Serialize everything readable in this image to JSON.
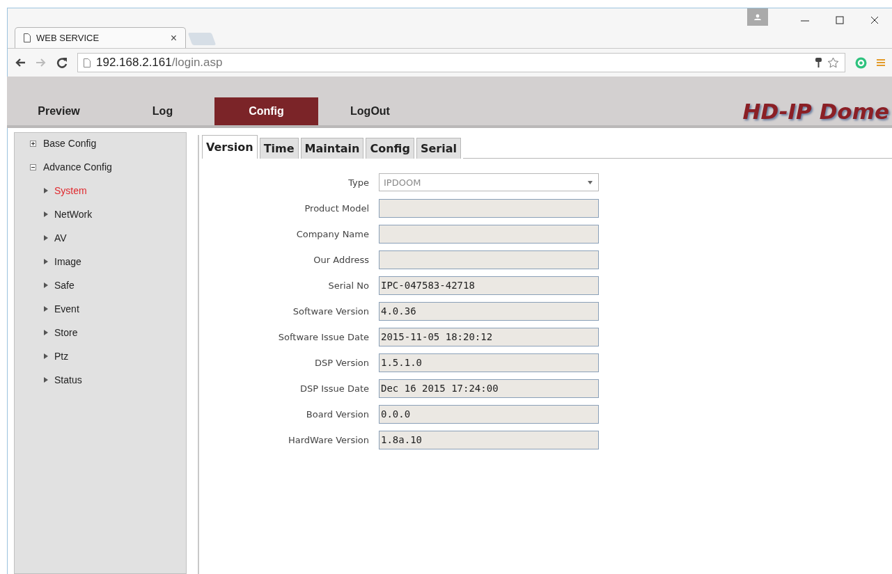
{
  "browser": {
    "tab_title": "WEB SERVICE",
    "tab_close": "×",
    "url_host": "192.168.2.161",
    "url_path": "/login.asp"
  },
  "nav": {
    "items": [
      {
        "label": "Preview",
        "selected": false
      },
      {
        "label": "Log",
        "selected": false
      },
      {
        "label": "Config",
        "selected": true
      },
      {
        "label": "LogOut",
        "selected": false
      }
    ],
    "logo": "HD-IP Dome"
  },
  "sidebar": {
    "items": [
      {
        "label": "Base Config",
        "expanded": false
      },
      {
        "label": "Advance Config",
        "expanded": true,
        "children": [
          {
            "label": "System",
            "selected": true
          },
          {
            "label": "NetWork",
            "selected": false
          },
          {
            "label": "AV",
            "selected": false
          },
          {
            "label": "Image",
            "selected": false
          },
          {
            "label": "Safe",
            "selected": false
          },
          {
            "label": "Event",
            "selected": false
          },
          {
            "label": "Store",
            "selected": false
          },
          {
            "label": "Ptz",
            "selected": false
          },
          {
            "label": "Status",
            "selected": false
          }
        ]
      }
    ]
  },
  "tabs": [
    {
      "label": "Version",
      "selected": true
    },
    {
      "label": "Time",
      "selected": false
    },
    {
      "label": "Maintain",
      "selected": false
    },
    {
      "label": "Config",
      "selected": false
    },
    {
      "label": "Serial",
      "selected": false
    }
  ],
  "form": [
    {
      "label": "Type",
      "kind": "select",
      "value": "IPDOOM"
    },
    {
      "label": "Product Model",
      "kind": "text"
    },
    {
      "label": "Company Name",
      "kind": "text"
    },
    {
      "label": "Our Address",
      "kind": "text"
    },
    {
      "label": "Serial No",
      "kind": "text",
      "value": "IPC-047583-42718"
    },
    {
      "label": "Software Version",
      "kind": "text",
      "value": "4.0.36"
    },
    {
      "label": "Software Issue Date",
      "kind": "text",
      "value": "2015-11-05 18:20:12"
    },
    {
      "label": "DSP Version",
      "kind": "text",
      "value": "1.5.1.0"
    },
    {
      "label": "DSP Issue Date",
      "kind": "text",
      "value": "Dec 16 2015 17:24:00"
    },
    {
      "label": "Board Version",
      "kind": "text",
      "value": "0.0.0"
    },
    {
      "label": "HardWare Version",
      "kind": "text",
      "value": "1.8a.10"
    }
  ]
}
